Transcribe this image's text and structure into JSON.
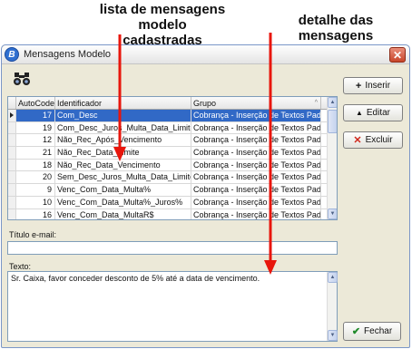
{
  "annotations": {
    "list_line1": "lista de mensagens modelo",
    "list_line2": "cadastradas",
    "detail": "detalhe das mensagens"
  },
  "window": {
    "title": "Mensagens Modelo",
    "close_glyph": "✕"
  },
  "toolbar": {
    "icon": "binoculars-icon"
  },
  "grid": {
    "columns": [
      "AutoCode",
      "Identificador",
      "Grupo"
    ],
    "sort_glyph": "^",
    "rows": [
      {
        "code": "17",
        "id": "Com_Desc",
        "group": "Cobrança - Inserção de Textos Padrões"
      },
      {
        "code": "19",
        "id": "Com_Desc_Juros_Multa_Data_Limite",
        "group": "Cobrança - Inserção de Textos Padrões"
      },
      {
        "code": "12",
        "id": "Não_Rec_Após_Vencimento",
        "group": "Cobrança - Inserção de Textos Padrões"
      },
      {
        "code": "21",
        "id": "Não_Rec_Data_Limite",
        "group": "Cobrança - Inserção de Textos Padrões"
      },
      {
        "code": "18",
        "id": "Não_Rec_Data_Vencimento",
        "group": "Cobrança - Inserção de Textos Padrões"
      },
      {
        "code": "20",
        "id": "Sem_Desc_Juros_Multa_Data_Limite",
        "group": "Cobrança - Inserção de Textos Padrões"
      },
      {
        "code": "9",
        "id": "Venc_Com_Data_Multa%",
        "group": "Cobrança - Inserção de Textos Padrões"
      },
      {
        "code": "10",
        "id": "Venc_Com_Data_Multa%_Juros%",
        "group": "Cobrança - Inserção de Textos Padrões"
      },
      {
        "code": "16",
        "id": "Venc_Com_Data_MultaR$",
        "group": "Cobrança - Inserção de Textos Padrões"
      }
    ]
  },
  "form": {
    "titulo_label": "Título e-mail:",
    "titulo_value": "",
    "texto_label": "Texto:",
    "texto_value": "Sr. Caixa, favor conceder desconto de 5% até a data de vencimento."
  },
  "buttons": {
    "inserir": "Inserir",
    "editar": "Editar",
    "excluir": "Excluir",
    "fechar": "Fechar"
  },
  "colors": {
    "selection": "#3169c6",
    "arrow": "#e8160c"
  }
}
